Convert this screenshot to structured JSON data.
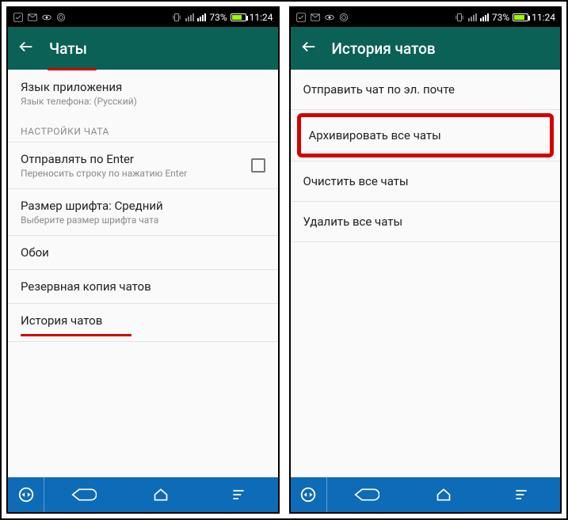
{
  "status": {
    "battery_pct": "73%",
    "time": "11:24"
  },
  "left": {
    "title": "Чаты",
    "lang_row": {
      "primary": "Язык приложения",
      "secondary": "Язык телефона: (Русский)"
    },
    "section": "НАСТРОЙКИ ЧАТА",
    "enter_row": {
      "primary": "Отправлять по Enter",
      "secondary": "Переносить строку по нажатию Enter"
    },
    "font_row": {
      "primary": "Размер шрифта: Средний",
      "secondary": "Выберите размер шрифта чата"
    },
    "wallpaper": "Обои",
    "backup": "Резервная копия чатов",
    "history": "История чатов"
  },
  "right": {
    "title": "История чатов",
    "email": "Отправить чат по эл. почте",
    "archive": "Архивировать все чаты",
    "clear": "Очистить все чаты",
    "delete": "Удалить все чаты"
  }
}
